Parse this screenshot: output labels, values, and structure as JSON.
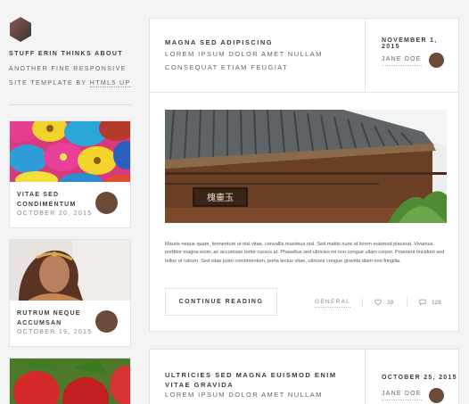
{
  "site": {
    "title": "STUFF ERIN THINKS ABOUT",
    "tagline_1": "ANOTHER FINE RESPONSIVE",
    "tagline_2": "SITE TEMPLATE BY",
    "tagline_link": "HTML5 UP"
  },
  "sidebar": {
    "mini_posts": [
      {
        "title": "VITAE SED CONDIMENTUM",
        "date": "OCTOBER 20, 2015",
        "image": "flowers"
      },
      {
        "title": "RUTRUM NEQUE ACCUMSAN",
        "date": "OCTOBER 19, 2015",
        "image": "portrait"
      },
      {
        "image": "strawberries"
      }
    ]
  },
  "posts": [
    {
      "title": "MAGNA SED ADIPISCING",
      "subtitle": "LOREM IPSUM DOLOR AMET NULLAM CONSEQUAT ETIAM FEUGIAT",
      "date": "NOVEMBER 1, 2015",
      "author": "JANE DOE",
      "image": "pagoda-roof",
      "image_sign": "槐壷玉",
      "excerpt": "Mauris neque quam, fermentum ut nisl vitae, convallis maximus nisl. Sed mattis nunc id lorem euismod placerat. Vivamus porttitor magna enim, ac accumsan tortor cursus at. Phasellus sed ultricies mi non congue ullam corper. Praesent tincidunt sed tellus ut rutrum. Sed vitae justo condimentum, porta lectus vitae, ultricies congue gravida diam non fringilla.",
      "button": "CONTINUE READING",
      "category": "GENERAL",
      "likes": "28",
      "comments": "128"
    },
    {
      "title": "ULTRICIES SED MAGNA EUISMOD ENIM VITAE GRAVIDA",
      "subtitle": "LOREM IPSUM DOLOR AMET NULLAM",
      "date": "OCTOBER 25, 2015",
      "author": "JANE DOE"
    }
  ],
  "colors": {
    "background": "#f4f4f4",
    "card": "#ffffff",
    "border": "#e4e4e4",
    "avatar": "#6b4a37",
    "text": "#3c3b3b"
  },
  "icons": {
    "logo": "hexagon-logo",
    "likes": "heart-icon",
    "comments": "chat-bubble-icon"
  }
}
